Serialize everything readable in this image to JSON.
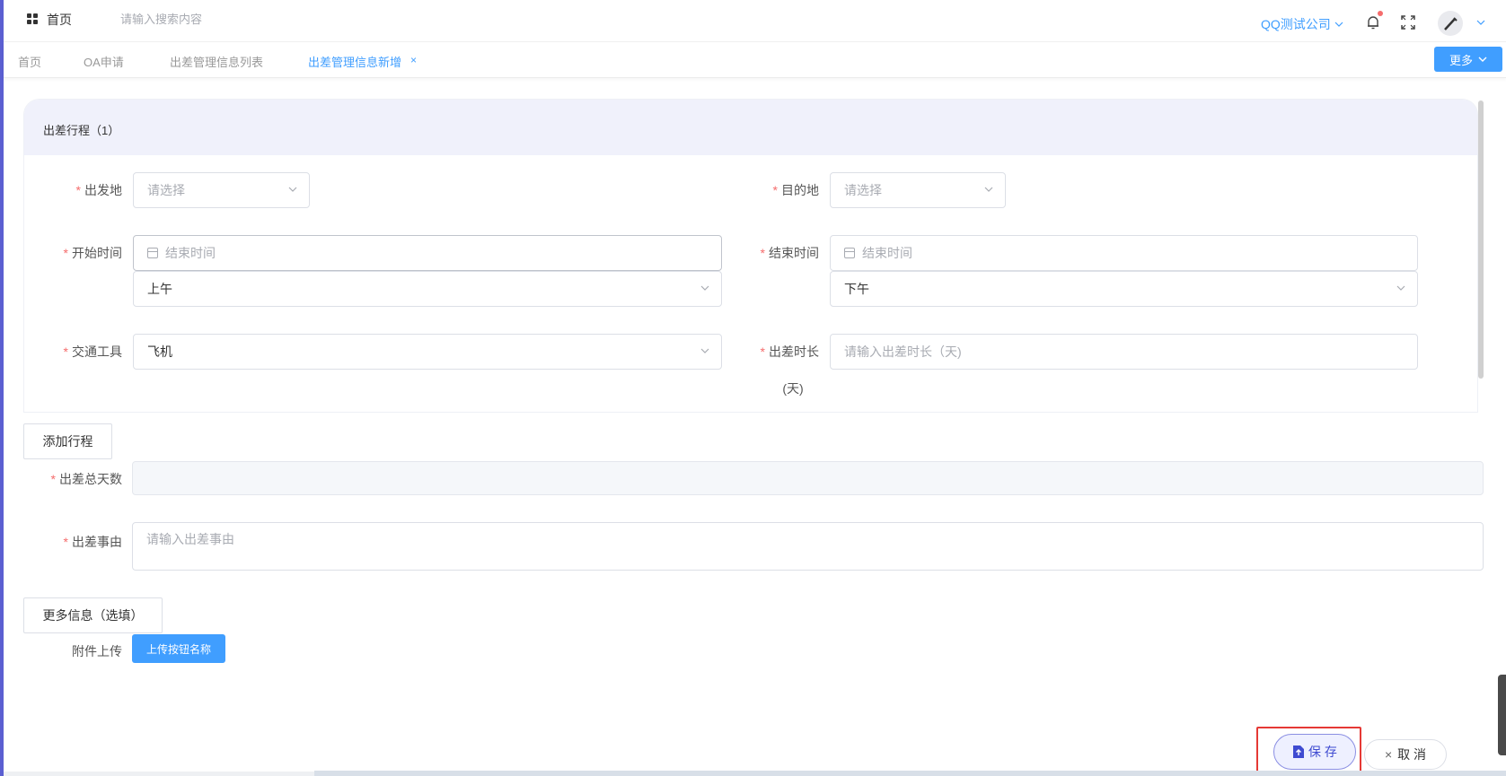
{
  "header": {
    "home_label": "首页",
    "search_placeholder": "请输入搜索内容",
    "company": "QQ测试公司"
  },
  "tabs": [
    {
      "label": "首页"
    },
    {
      "label": "OA申请"
    },
    {
      "label": "出差管理信息列表"
    },
    {
      "label": "出差管理信息新增",
      "active": true
    }
  ],
  "more_button": "更多",
  "itinerary": {
    "title": "出差行程（1）",
    "departure": {
      "label": "出发地",
      "placeholder": "请选择"
    },
    "destination": {
      "label": "目的地",
      "placeholder": "请选择"
    },
    "start_time": {
      "label": "开始时间",
      "placeholder": "结束时间",
      "period": "上午"
    },
    "end_time": {
      "label": "结束时间",
      "placeholder": "结束时间",
      "period": "下午"
    },
    "transport": {
      "label": "交通工具",
      "value": "飞机"
    },
    "duration": {
      "label_line1": "出差时长",
      "label_line2": "(天)",
      "placeholder": "请输入出差时长（天)"
    }
  },
  "add_itinerary_button": "添加行程",
  "total_days": {
    "label": "出差总天数",
    "value": ""
  },
  "reason": {
    "label": "出差事由",
    "placeholder": "请输入出差事由"
  },
  "more_info_button": "更多信息（选填）",
  "attachment": {
    "label": "附件上传",
    "button": "上传按钮名称"
  },
  "actions": {
    "save": "保 存",
    "cancel": "取 消"
  },
  "colors": {
    "primary": "#409eff",
    "required": "#f56c6c",
    "card_header": "#f0f1fb",
    "save_border": "#8a8ee3",
    "highlight": "#e53935"
  }
}
